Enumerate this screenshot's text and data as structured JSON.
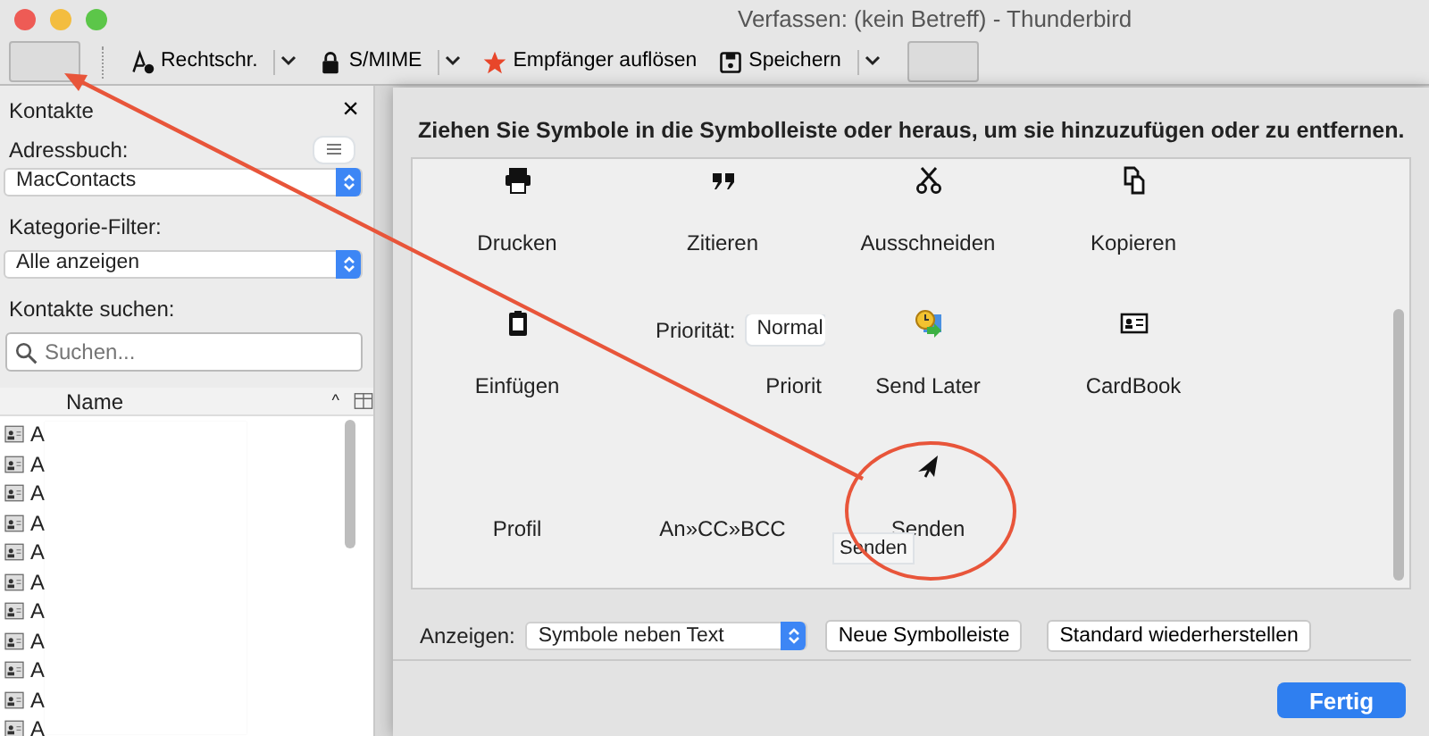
{
  "window": {
    "title": "Verfassen: (kein Betreff) - Thunderbird"
  },
  "toolbar": [
    {
      "kind": "placeholder"
    },
    {
      "kind": "split",
      "label": "Rechtschr."
    },
    {
      "kind": "split",
      "label": "S/MIME"
    },
    {
      "kind": "button",
      "label": "Empfänger auflösen"
    },
    {
      "kind": "split",
      "label": "Speichern"
    },
    {
      "kind": "placeholder"
    }
  ],
  "sidebar": {
    "title": "Kontakte",
    "close": "×",
    "address_book_label": "Adressbuch:",
    "address_book": "MacContacts",
    "category_label": "Kategorie-Filter:",
    "category": "Alle anzeigen",
    "search_label": "Kontakte suchen:",
    "search": {
      "placeholder": "Suchen..."
    },
    "column": "Name",
    "sort": "^",
    "rows": [
      "A",
      "A",
      "A",
      "A",
      "A",
      "A",
      "A",
      "A",
      "A",
      "A",
      "A"
    ]
  },
  "customize": {
    "instruction": "Ziehen Sie Symbole in die Symbolleiste oder heraus, um sie hinzuzufügen oder zu entfernen.",
    "items": [
      {
        "kind": "button",
        "label": "Drucken"
      },
      {
        "kind": "button",
        "label": "Zitieren"
      },
      {
        "kind": "button",
        "label": "Ausschneiden"
      },
      {
        "kind": "button",
        "label": "Kopieren"
      },
      {
        "kind": "button",
        "label": "Einfügen"
      },
      {
        "kind": "dropdown",
        "label": "Priorit",
        "field_label": "Priorität:",
        "value": "Normal"
      },
      {
        "kind": "button",
        "label": "Send Later"
      },
      {
        "kind": "button",
        "label": "CardBook"
      },
      {
        "kind": "text",
        "label": "Profil"
      },
      {
        "kind": "text",
        "label": "An»CC»BCC"
      },
      {
        "kind": "button",
        "label": "Senden",
        "tooltip": "Senden"
      }
    ],
    "show_label": "Anzeigen:",
    "show_value": "Symbole neben Text",
    "buttons": [
      "Neue Symbolleiste",
      "Standard wiederherstellen"
    ],
    "done": "Fertig"
  }
}
